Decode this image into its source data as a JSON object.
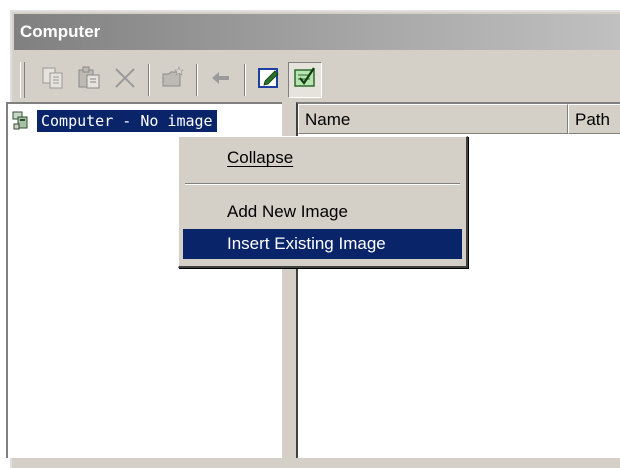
{
  "window": {
    "title": "Computer"
  },
  "toolbar": {
    "buttons": [
      {
        "name": "copy-icon",
        "enabled": false
      },
      {
        "name": "paste-icon",
        "enabled": false
      },
      {
        "name": "delete-icon",
        "enabled": false
      },
      {
        "name": "new-folder-icon",
        "enabled": false
      },
      {
        "name": "back-arrow-icon",
        "enabled": false
      },
      {
        "name": "edit-note-icon",
        "enabled": true
      },
      {
        "name": "checklist-icon",
        "enabled": true,
        "pressed": true
      }
    ]
  },
  "tree": {
    "selected_item": {
      "icon": "computer-icon",
      "label": "Computer - No image"
    }
  },
  "list": {
    "columns": [
      "Name",
      "Path"
    ]
  },
  "context_menu": {
    "items": [
      {
        "label": "Collapse",
        "highlighted": false
      },
      {
        "label": "Add New Image",
        "highlighted": false
      },
      {
        "label": "Insert Existing Image",
        "highlighted": true
      }
    ]
  },
  "colors": {
    "face": "#d4d0c8",
    "highlight": "#0a246a",
    "title_gradient_start": "#808080"
  }
}
